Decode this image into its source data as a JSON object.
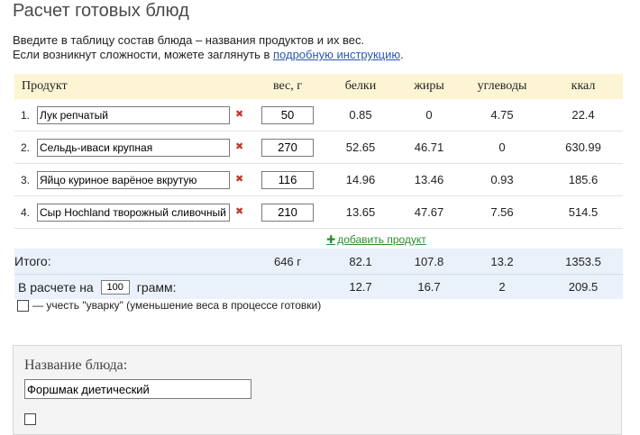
{
  "page": {
    "title": "Расчет готовых блюд",
    "intro_line1": "Введите в таблицу состав блюда – названия продуктов и их вес.",
    "intro_line2_prefix": "Если возникнут сложности, можете заглянуть в ",
    "intro_link": "подробную инструкцию",
    "intro_line2_suffix": "."
  },
  "table": {
    "headers": {
      "product": "Продукт",
      "weight": "вес, г",
      "protein": "белки",
      "fat": "жиры",
      "carbs": "углеводы",
      "kcal": "ккал"
    },
    "rows": [
      {
        "num": "1.",
        "product": "Лук репчатый",
        "weight": "50",
        "protein": "0.85",
        "fat": "0",
        "carbs": "4.75",
        "kcal": "22.4"
      },
      {
        "num": "2.",
        "product": "Сельдь-иваси крупная",
        "weight": "270",
        "protein": "52.65",
        "fat": "46.71",
        "carbs": "0",
        "kcal": "630.99"
      },
      {
        "num": "3.",
        "product": "Яйцо куриное варёное вкрутую",
        "weight": "116",
        "protein": "14.96",
        "fat": "13.46",
        "carbs": "0.93",
        "kcal": "185.6"
      },
      {
        "num": "4.",
        "product": "Сыр Hochland творожный сливочный",
        "weight": "210",
        "protein": "13.65",
        "fat": "47.67",
        "carbs": "7.56",
        "kcal": "514.5"
      }
    ],
    "add_product": "добавить продукт",
    "total": {
      "label": "Итого:",
      "weight": "646 г",
      "protein": "82.1",
      "fat": "107.8",
      "carbs": "13.2",
      "kcal": "1353.5"
    },
    "per": {
      "prefix": "В расчете на",
      "amount": "100",
      "suffix": "грамм:",
      "protein": "12.7",
      "fat": "16.7",
      "carbs": "2",
      "kcal": "209.5"
    }
  },
  "uvarka_label": "— учесть \"уварку\" (уменьшение веса в процессе готовки)",
  "dish": {
    "label": "Название блюда:",
    "name": "Форшмак диетический"
  }
}
